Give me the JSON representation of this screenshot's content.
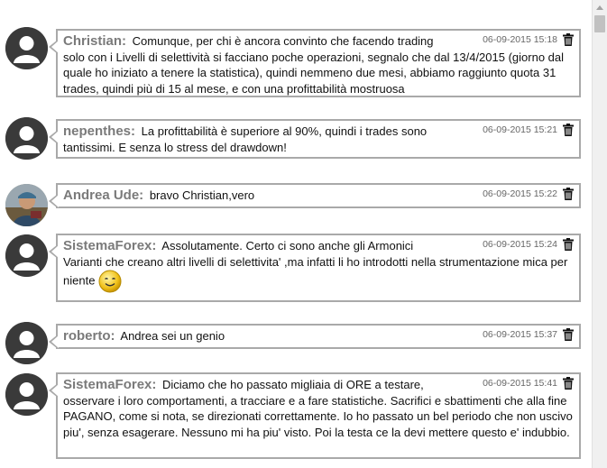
{
  "comments": [
    {
      "author": "Christian:",
      "timestamp": "06-09-2015 15:18",
      "avatar": "default-avatar-icon",
      "line1": "Comunque, per chi è ancora convinto che facendo trading",
      "rest": "solo con i Livelli di selettività si facciano poche operazioni, segnalo che dal 13/4/2015 (giorno dal quale ho iniziato a tenere la statistica), quindi nemmeno due mesi, abbiamo raggiunto quota 31 trades, quindi più di 15 al mese, e con una profittabilità mostruosa"
    },
    {
      "author": "nepenthes:",
      "timestamp": "06-09-2015 15:21",
      "avatar": "default-avatar-icon",
      "line1": "La profittabilità è superiore al 90%, quindi i trades sono",
      "rest": "tantissimi. E senza lo stress del drawdown!"
    },
    {
      "author": "Andrea Ude:",
      "timestamp": "06-09-2015 15:22",
      "avatar": "photo-avatar",
      "line1": "bravo Christian,vero",
      "rest": ""
    },
    {
      "author": "SistemaForex:",
      "timestamp": "06-09-2015 15:24",
      "avatar": "default-avatar-icon",
      "line1": "Assolutamente. Certo ci sono anche gli Armonici",
      "rest": "Varianti che creano altri livelli di selettivita' ,ma infatti li ho introdotti nella strumentazione mica per niente",
      "emoticon": "smiley-icon"
    },
    {
      "author": "roberto:",
      "timestamp": "06-09-2015 15:37",
      "avatar": "default-avatar-icon",
      "line1": "Andrea sei un genio",
      "rest": ""
    },
    {
      "author": "SistemaForex:",
      "timestamp": "06-09-2015 15:41",
      "avatar": "default-avatar-icon",
      "line1": "Diciamo che ho passato migliaia di ORE a testare,",
      "rest": "osservare i loro comportamenti, a tracciare e a fare statistiche. Sacrifici e sbattimenti che alla fine PAGANO, come si nota, se direzionati correttamente. Io ho passato un bel periodo che non uscivo piu', senza esagerare. Nessuno mi ha piu' visto. Poi la testa ce la devi mettere questo e' indubbio."
    }
  ],
  "icons": {
    "delete": "trash-icon",
    "scroll_up": "scroll-up-arrow-icon"
  },
  "colors": {
    "border": "#a9a9a9",
    "author": "#7a7a7a",
    "timestamp": "#666666"
  }
}
